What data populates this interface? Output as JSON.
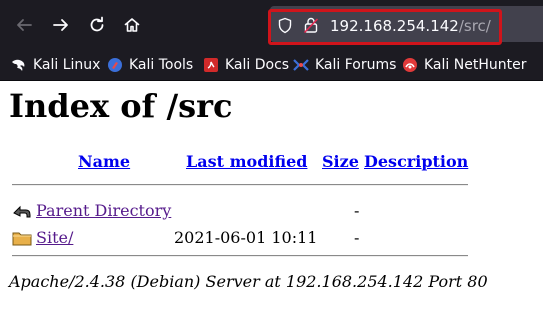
{
  "browser": {
    "url_host": "192.168.254.142",
    "url_path": "/src/",
    "nav": {
      "back_icon": "back-arrow-icon",
      "forward_icon": "forward-arrow-icon",
      "reload_icon": "reload-icon",
      "home_icon": "home-icon"
    },
    "colors": {
      "chrome": "#1c1b22",
      "url_highlight": "#d0141b"
    }
  },
  "bookmarks": [
    {
      "label": "Kali Linux",
      "icon": "kali-dragon-icon"
    },
    {
      "label": "Kali Tools",
      "icon": "kali-tools-icon"
    },
    {
      "label": "Kali Docs",
      "icon": "kali-docs-icon"
    },
    {
      "label": "Kali Forums",
      "icon": "kali-forums-icon"
    },
    {
      "label": "Kali NetHunter",
      "icon": "nethunter-icon"
    }
  ],
  "page": {
    "title": "Index of /src",
    "columns": {
      "name": "Name",
      "last_modified": "Last modified",
      "size": "Size",
      "description": "Description"
    },
    "rows": [
      {
        "name": "Parent Directory",
        "last_modified": "",
        "size": "-",
        "icon": "back-folder-icon"
      },
      {
        "name": "Site/",
        "last_modified": "2021-06-01 10:11",
        "size": "-",
        "icon": "folder-icon"
      }
    ],
    "address": "Apache/2.4.38 (Debian) Server at 192.168.254.142 Port 80"
  }
}
